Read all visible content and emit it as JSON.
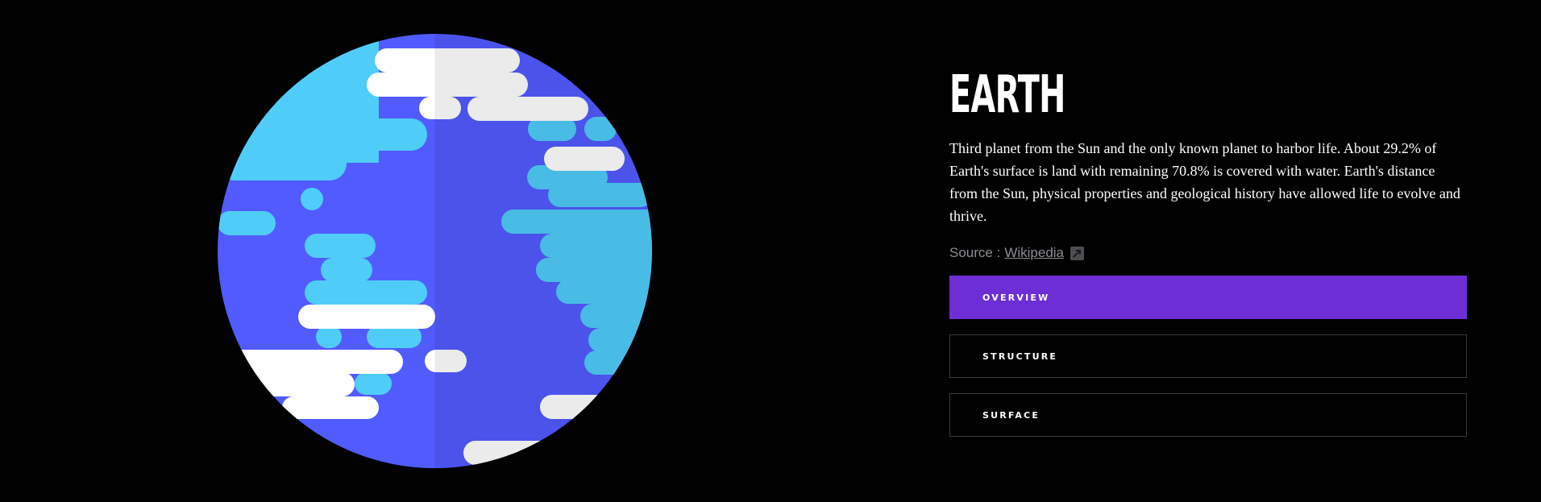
{
  "planet": {
    "name": "EARTH",
    "description": "Third planet from the Sun and the only known planet to harbor life. About 29.2% of Earth's surface is land with remaining 70.8% is covered with water. Earth's distance from the Sun, physical properties and geological history have allowed life to evolve and thrive.",
    "image_icon": "earth-planet-illustration"
  },
  "source": {
    "label": "Source :",
    "link_text": "Wikipedia",
    "link_icon": "external-link-icon"
  },
  "tabs": [
    {
      "label": "OVERVIEW",
      "active": true
    },
    {
      "label": "STRUCTURE",
      "active": false
    },
    {
      "label": "SURFACE",
      "active": false
    }
  ],
  "colors": {
    "background": "#000000",
    "active_tab": "#6d2ed5",
    "tab_border": "#3a3a3f",
    "ocean": "#525bff",
    "land": "#4fcdf8",
    "clouds": "#ffffff",
    "secondary_text": "#8c8c92"
  }
}
